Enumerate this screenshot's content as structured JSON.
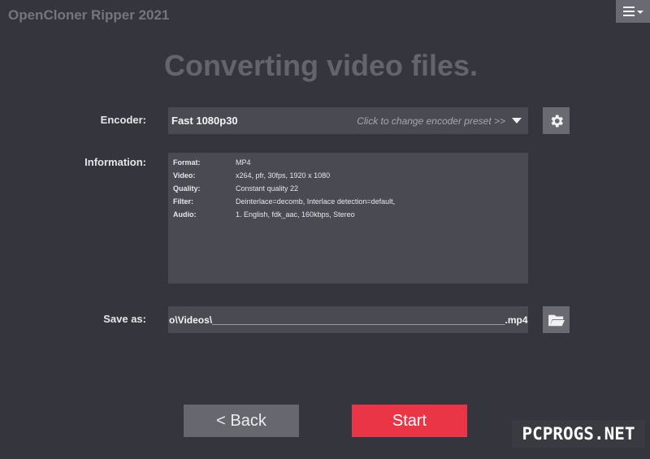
{
  "app": {
    "title": "OpenCloner Ripper 2021"
  },
  "heading": "Converting video files.",
  "encoder": {
    "label": "Encoder:",
    "value": "Fast 1080p30",
    "hint": "Click to change encoder preset >>"
  },
  "information": {
    "label": "Information:",
    "rows": [
      {
        "key": "Format:",
        "value": "MP4"
      },
      {
        "key": "Video:",
        "value": "x264, pfr, 30fps, 1920 x 1080"
      },
      {
        "key": "Quality:",
        "value": "Constant quality 22"
      },
      {
        "key": "Filter:",
        "value": "Deinterlace=decomb, Interlace detection=default,"
      },
      {
        "key": "Audio:",
        "value": "1. English, fdk_aac, 160kbps, Stereo"
      }
    ]
  },
  "save": {
    "label": "Save as:",
    "value": "o\\Videos\\______________________________________________________.mp4"
  },
  "buttons": {
    "back": "<  Back",
    "start": "Start"
  },
  "watermark": "PCPROGS.NET",
  "colors": {
    "background": "#35363d",
    "field": "#4a4b52",
    "accent": "#ea3547",
    "button": "#67686f"
  },
  "icons": {
    "menu": "hamburger-icon",
    "settings": "gear-icon",
    "browse": "folder-icon"
  }
}
